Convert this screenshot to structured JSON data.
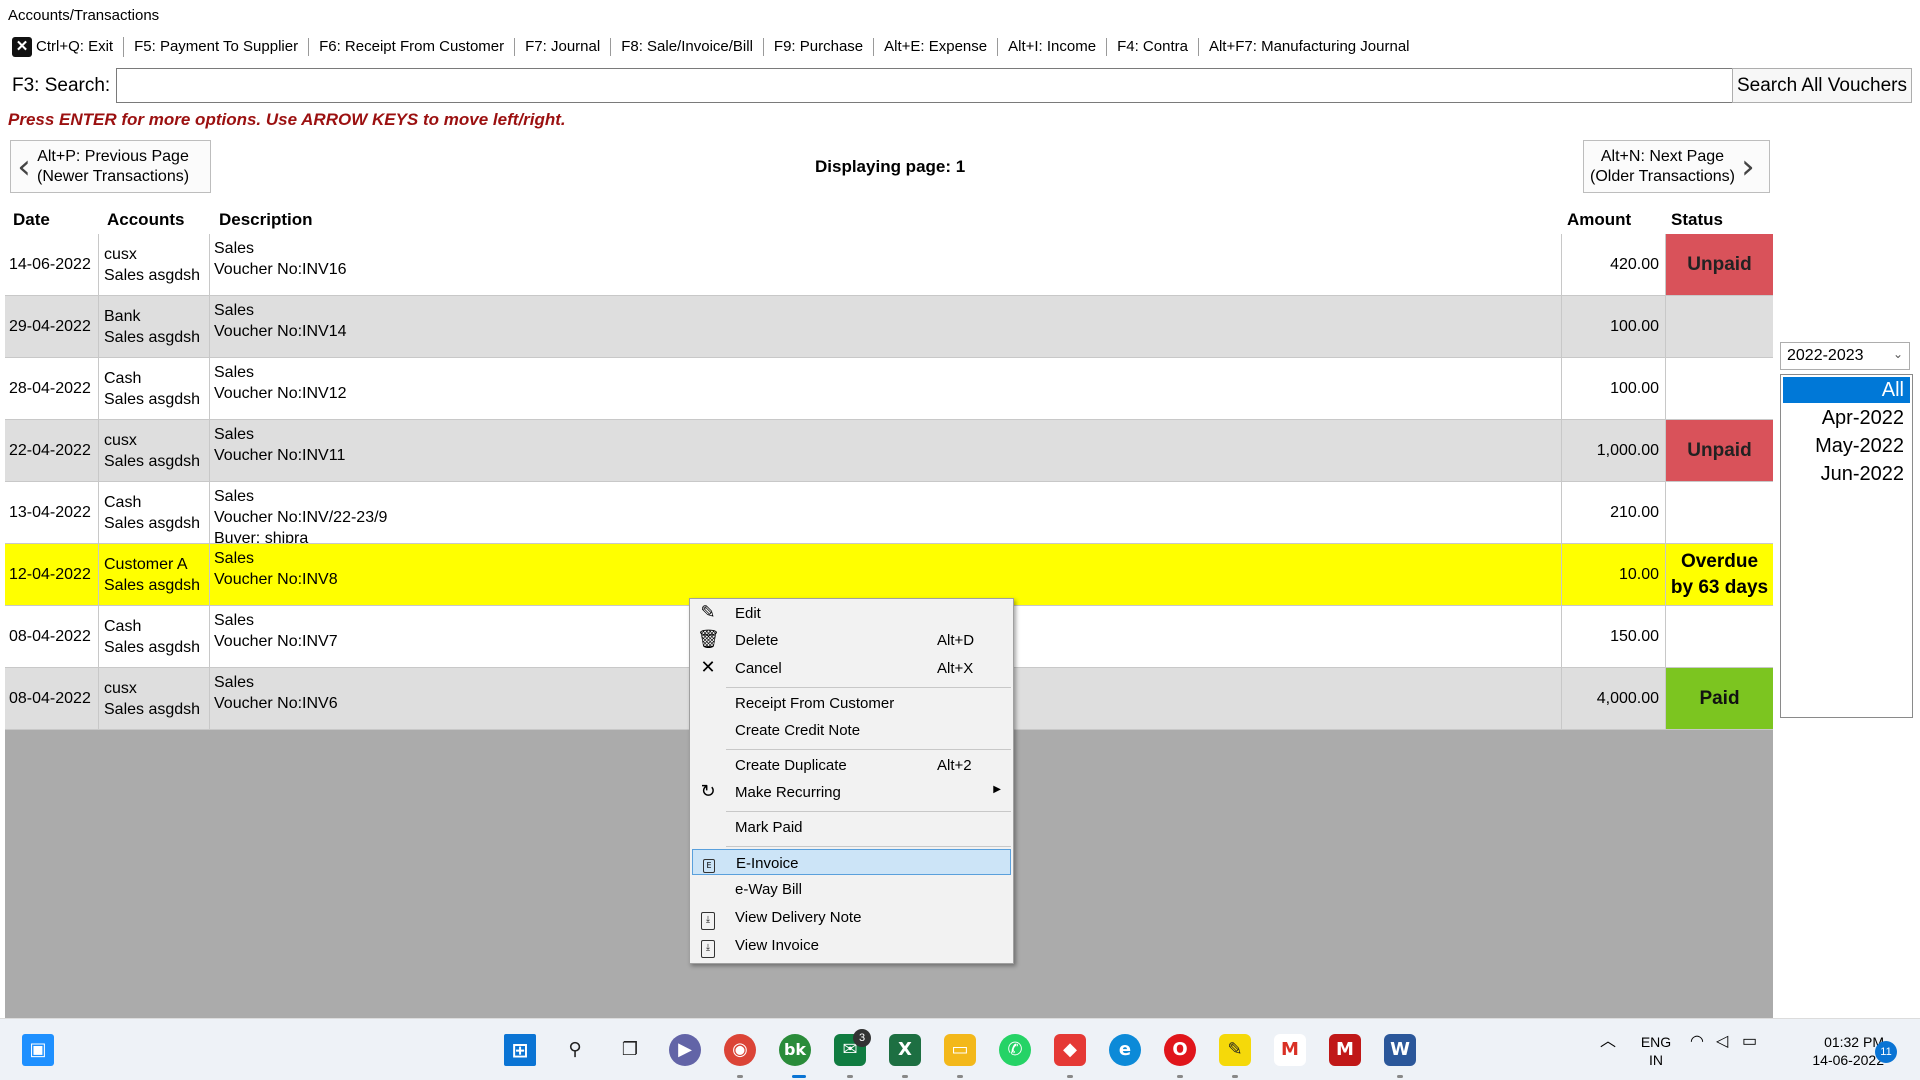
{
  "window": {
    "title": "Accounts/Transactions"
  },
  "shortcuts": [
    "Ctrl+Q: Exit",
    "F5: Payment To Supplier",
    "F6: Receipt From Customer",
    "F7: Journal",
    "F8: Sale/Invoice/Bill",
    "F9: Purchase",
    "Alt+E: Expense",
    "Alt+I: Income",
    "F4: Contra",
    "Alt+F7: Manufacturing Journal"
  ],
  "search": {
    "label": "F3: Search:",
    "value": "",
    "button": "Search All Vouchers"
  },
  "hint": "Press ENTER for more options. Use ARROW KEYS to move left/right.",
  "nav": {
    "prev_line1": "Alt+P: Previous Page",
    "prev_line2": "(Newer Transactions)",
    "page_label": "Displaying page: 1",
    "next_line1": "Alt+N: Next Page",
    "next_line2": "(Older Transactions)"
  },
  "table": {
    "headers": {
      "date": "Date",
      "accounts": "Accounts",
      "description": "Description",
      "amount": "Amount",
      "status": "Status"
    },
    "rows": [
      {
        "date": "14-06-2022",
        "acc1": "cusx",
        "acc2": "Sales asgdsh",
        "desc1": "Sales",
        "desc2": "Voucher No:INV16",
        "desc3": "",
        "amount": "420.00",
        "status1": "Unpaid",
        "status2": ""
      },
      {
        "date": "29-04-2022",
        "acc1": "Bank",
        "acc2": "Sales asgdsh",
        "desc1": "Sales",
        "desc2": "Voucher No:INV14",
        "desc3": "",
        "amount": "100.00",
        "status1": "",
        "status2": ""
      },
      {
        "date": "28-04-2022",
        "acc1": "Cash",
        "acc2": "Sales asgdsh",
        "desc1": "Sales",
        "desc2": "Voucher No:INV12",
        "desc3": "",
        "amount": "100.00",
        "status1": "",
        "status2": ""
      },
      {
        "date": "22-04-2022",
        "acc1": "cusx",
        "acc2": "Sales asgdsh",
        "desc1": "Sales",
        "desc2": "Voucher No:INV11",
        "desc3": "",
        "amount": "1,000.00",
        "status1": "Unpaid",
        "status2": ""
      },
      {
        "date": "13-04-2022",
        "acc1": "Cash",
        "acc2": "Sales asgdsh",
        "desc1": "Sales",
        "desc2": "Voucher No:INV/22-23/9",
        "desc3": "Buyer: shipra",
        "amount": "210.00",
        "status1": "",
        "status2": ""
      },
      {
        "date": "12-04-2022",
        "acc1": "Customer A",
        "acc2": "Sales asgdsh",
        "desc1": "Sales",
        "desc2": "Voucher No:INV8",
        "desc3": "",
        "amount": "10.00",
        "status1": "Overdue",
        "status2": "by 63 days"
      },
      {
        "date": "08-04-2022",
        "acc1": "Cash",
        "acc2": "Sales asgdsh",
        "desc1": "Sales",
        "desc2": "Voucher No:INV7",
        "desc3": "",
        "amount": "150.00",
        "status1": "",
        "status2": ""
      },
      {
        "date": "08-04-2022",
        "acc1": "cusx",
        "acc2": "Sales asgdsh",
        "desc1": "Sales",
        "desc2": "Voucher No:INV6",
        "desc3": "",
        "amount": "4,000.00",
        "status1": "Paid",
        "status2": ""
      }
    ]
  },
  "period": {
    "fiscal_year": "2022-2023",
    "months": [
      "All",
      "Apr-2022",
      "May-2022",
      "Jun-2022"
    ],
    "selected": "All"
  },
  "context_menu": {
    "highlighted": "E-Invoice",
    "items": [
      {
        "label": "Edit",
        "shortcut": "",
        "icon": "pencil-icon"
      },
      {
        "label": "Delete",
        "shortcut": "Alt+D",
        "icon": "trash-icon"
      },
      {
        "label": "Cancel",
        "shortcut": "Alt+X",
        "icon": "x-icon"
      },
      {
        "label": "Receipt From Customer",
        "shortcut": ""
      },
      {
        "label": "Create Credit Note",
        "shortcut": ""
      },
      {
        "label": "Create Duplicate",
        "shortcut": "Alt+2"
      },
      {
        "label": "Make Recurring",
        "shortcut": "",
        "icon": "refresh-icon"
      },
      {
        "label": "Mark Paid",
        "shortcut": ""
      },
      {
        "label": "E-Invoice",
        "shortcut": "",
        "icon": "document-icon"
      },
      {
        "label": "e-Way Bill",
        "shortcut": ""
      },
      {
        "label": "View Delivery Note",
        "shortcut": "",
        "icon": "pdf-icon"
      },
      {
        "label": "View Invoice",
        "shortcut": "",
        "icon": "pdf-icon"
      }
    ]
  },
  "taskbar": {
    "teams_badge": "3",
    "language1": "ENG",
    "language2": "IN",
    "time": "01:32 PM",
    "date": "14-06-2022",
    "notifications": "11"
  },
  "colors": {
    "unpaid": "#d9525a",
    "paid": "#7cc520",
    "overdue_row": "#ffff00",
    "hint": "#9b1010",
    "selection": "#0078d7"
  }
}
